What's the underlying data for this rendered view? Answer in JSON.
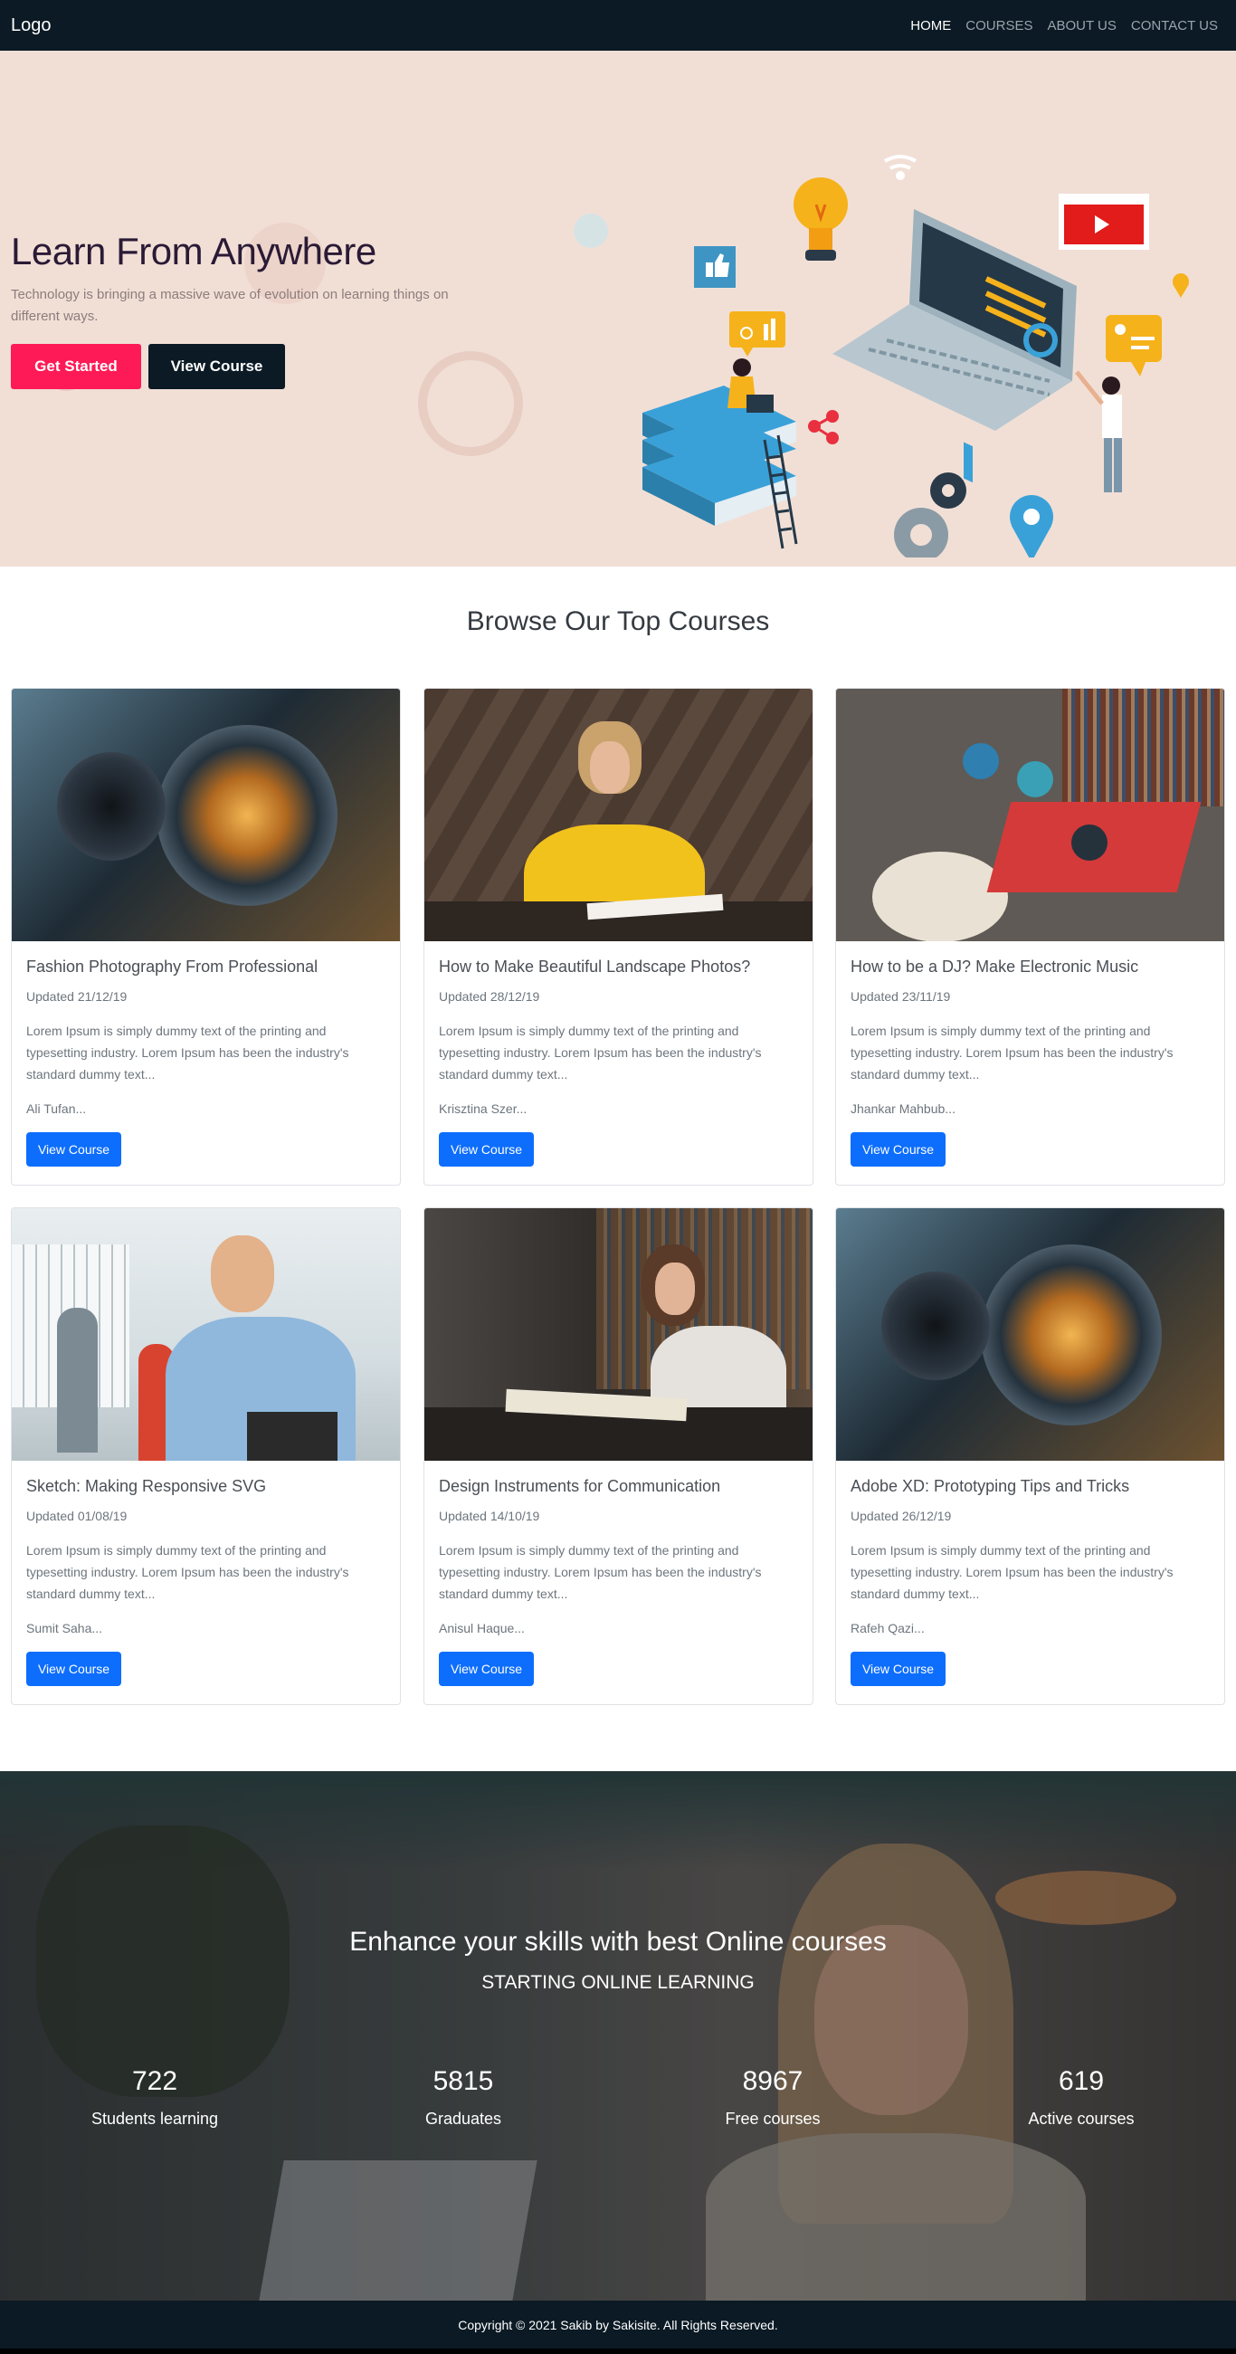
{
  "navbar": {
    "logo": "Logo",
    "links": [
      {
        "label": "HOME"
      },
      {
        "label": "COURSES"
      },
      {
        "label": "ABOUT US"
      },
      {
        "label": "CONTACT US"
      }
    ]
  },
  "hero": {
    "title": "Learn From Anywhere",
    "text": "Technology is bringing a massive wave of evolution on learning things on different ways.",
    "primary_button": "Get Started",
    "secondary_button": "View Course",
    "background_color": "#f1dfd6",
    "accent_color": "#fe1a56"
  },
  "courses": {
    "title": "Browse Our Top Courses",
    "items": [
      {
        "title": "Fashion Photography From Professional",
        "updated": "Updated 21/12/19",
        "text": "Lorem Ipsum is simply dummy text of the printing and typesetting industry. Lorem Ipsum has been the industry's standard dummy text...",
        "author": "Ali Tufan...",
        "button": "View Course",
        "image": "camera-lens-image"
      },
      {
        "title": "How to Make Beautiful Landscape Photos?",
        "updated": "Updated 28/12/19",
        "text": "Lorem Ipsum is simply dummy text of the printing and typesetting industry. Lorem Ipsum has been the industry's standard dummy text...",
        "author": "Krisztina Szer...",
        "button": "View Course",
        "image": "woman-writing-image"
      },
      {
        "title": "How to be a DJ? Make Electronic Music",
        "updated": "Updated 23/11/19",
        "text": "Lorem Ipsum is simply dummy text of the printing and typesetting industry. Lorem Ipsum has been the industry's standard dummy text...",
        "author": "Jhankar Mahbub...",
        "button": "View Course",
        "image": "students-group-image"
      },
      {
        "title": "Sketch: Making Responsive SVG",
        "updated": "Updated 01/08/19",
        "text": "Lorem Ipsum is simply dummy text of the printing and typesetting industry. Lorem Ipsum has been the industry's standard dummy text...",
        "author": "Sumit Saha...",
        "button": "View Course",
        "image": "student-backpack-image"
      },
      {
        "title": "Design Instruments for Communication",
        "updated": "Updated 14/10/19",
        "text": "Lorem Ipsum is simply dummy text of the printing and typesetting industry. Lorem Ipsum has been the industry's standard dummy text...",
        "author": "Anisul Haque...",
        "button": "View Course",
        "image": "woman-library-image"
      },
      {
        "title": "Adobe XD: Prototyping Tips and Tricks",
        "updated": "Updated 26/12/19",
        "text": "Lorem Ipsum is simply dummy text of the printing and typesetting industry. Lorem Ipsum has been the industry's standard dummy text...",
        "author": "Rafeh Qazi...",
        "button": "View Course",
        "image": "camera-lens-image"
      }
    ]
  },
  "stats": {
    "title": "Enhance your skills with best Online courses",
    "subtitle": "STARTING ONLINE LEARNING",
    "items": [
      {
        "value": "722",
        "label": "Students learning"
      },
      {
        "value": "5815",
        "label": "Graduates"
      },
      {
        "value": "8967",
        "label": "Free courses"
      },
      {
        "value": "619",
        "label": "Active courses"
      }
    ]
  },
  "footer": {
    "copyright": "Copyright © 2021 Sakib by Sakisite. All Rights Reserved."
  },
  "colors": {
    "navbar": "#0b1a24",
    "primary": "#0d6efd"
  }
}
